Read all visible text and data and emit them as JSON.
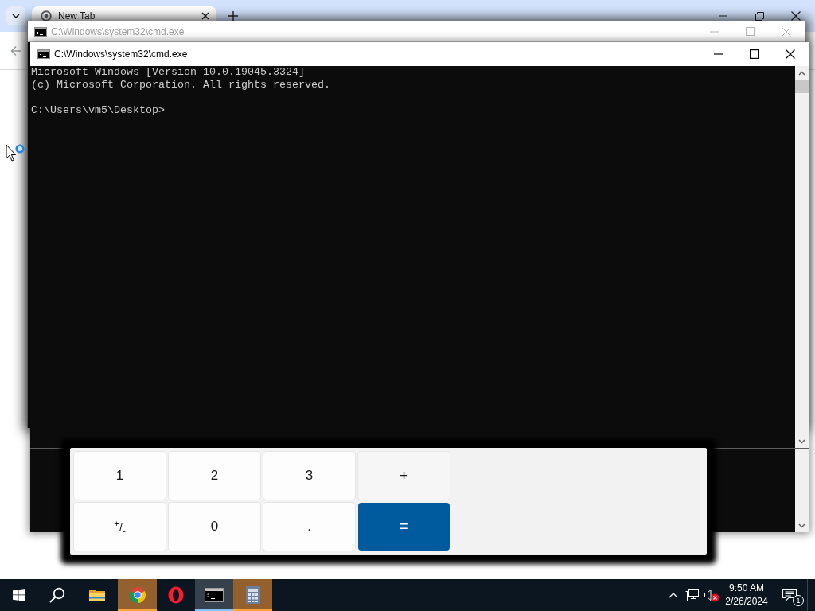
{
  "browser": {
    "tab": {
      "title": "New Tab"
    }
  },
  "background_console": {
    "title": "C:\\Windows\\system32\\cmd.exe",
    "active": false
  },
  "console": {
    "title": "C:\\Windows\\system32\\cmd.exe",
    "active": true,
    "output": [
      "Microsoft Windows [Version 10.0.19045.3324]",
      "(c) Microsoft Corporation. All rights reserved."
    ],
    "prompt": "C:\\Users\\vm5\\Desktop>"
  },
  "calculator": {
    "keys": [
      {
        "label": "1",
        "kind": "digit"
      },
      {
        "label": "2",
        "kind": "digit"
      },
      {
        "label": "3",
        "kind": "digit"
      },
      {
        "label": "+",
        "kind": "operator"
      },
      {
        "label": "$^{+}$/$_{-}$",
        "kind": "sign"
      },
      {
        "label": "0",
        "kind": "digit"
      },
      {
        "label": ".",
        "kind": "digit"
      },
      {
        "label": "=",
        "kind": "equals"
      }
    ]
  },
  "taskbar": {
    "buttons": [
      {
        "kind": "start",
        "selected": false,
        "flashing": false
      },
      {
        "kind": "search",
        "selected": false,
        "flashing": false
      },
      {
        "kind": "files",
        "selected": false,
        "flashing": false
      },
      {
        "kind": "browser",
        "selected": false,
        "flashing": true
      },
      {
        "kind": "altbrowser",
        "selected": false,
        "flashing": false
      },
      {
        "kind": "terminal",
        "selected": true,
        "flashing": false
      },
      {
        "kind": "calculator",
        "selected": false,
        "flashing": true
      }
    ],
    "tray": {
      "muted": true,
      "time": "9:50 AM",
      "date": "2/26/2024",
      "notifications": "1"
    }
  }
}
